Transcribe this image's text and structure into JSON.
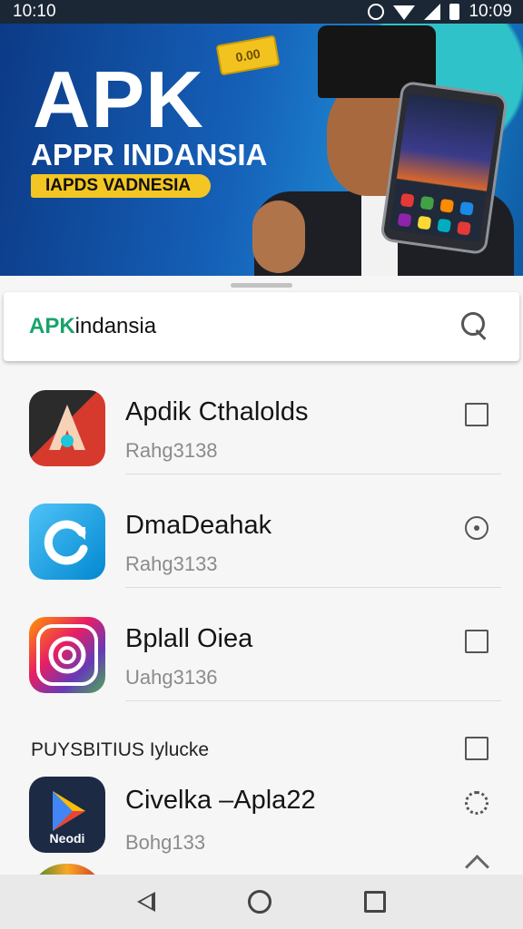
{
  "status_bar": {
    "left_time": "10:10",
    "right_time": "10:09"
  },
  "banner": {
    "title": "APK",
    "subtitle": "APPR INDANSIA",
    "tag": "IAPDS VADNESIA",
    "sticker": "0.00"
  },
  "search": {
    "brand": "APK",
    "query_rest": "indansia"
  },
  "apps": [
    {
      "name": "Apdik Cthalolds",
      "sub": "Rahg3138",
      "action": "square",
      "icon_colors": [
        "#d63a2c",
        "#2b2b2b"
      ]
    },
    {
      "name": "DmaDeahak",
      "sub": "Rahg3133",
      "action": "circle",
      "icon_colors": [
        "#29b6f6",
        "#0288d1"
      ]
    },
    {
      "name": "Bplall Oiea",
      "sub": "Uahg3136",
      "action": "square",
      "icon_colors": [
        "#e91e63",
        "#673ab7"
      ]
    }
  ],
  "section_header": "PUYSBITIUS Iylucke",
  "featured_app": {
    "name": "Civelka –Apla22",
    "sub": "Bohg133",
    "icon_label": "Neodi"
  },
  "navbar": {
    "back": "back",
    "home": "home",
    "recents": "recents"
  }
}
